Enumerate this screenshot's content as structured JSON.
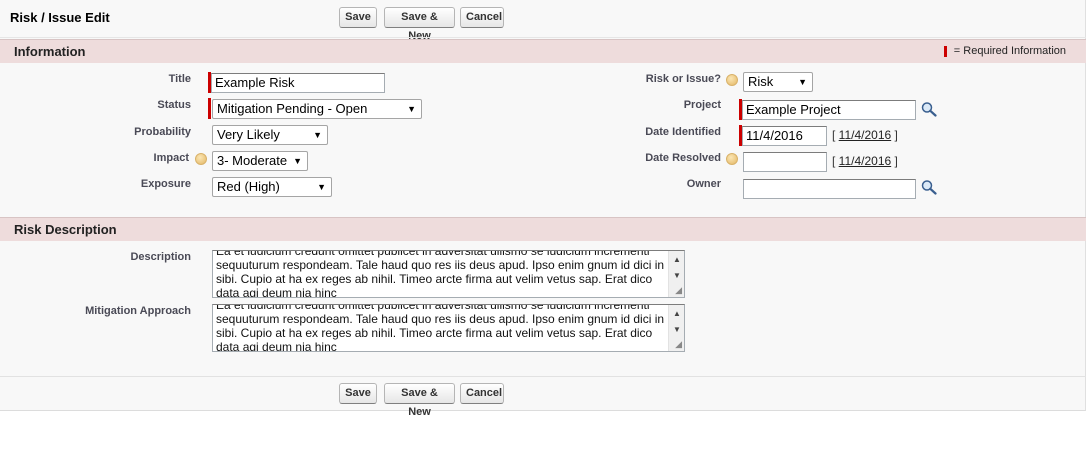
{
  "page": {
    "title": "Risk / Issue Edit",
    "buttons": {
      "save": "Save",
      "save_new": "Save & New",
      "cancel": "Cancel"
    }
  },
  "sections": {
    "information": {
      "title": "Information",
      "required_legend": "= Required Information"
    },
    "risk_description": {
      "title": "Risk Description"
    }
  },
  "fields": {
    "title": {
      "label": "Title",
      "value": "Example Risk"
    },
    "status": {
      "label": "Status",
      "value": "Mitigation Pending - Open"
    },
    "probability": {
      "label": "Probability",
      "value": "Very Likely"
    },
    "impact": {
      "label": "Impact",
      "value": "3- Moderate"
    },
    "exposure": {
      "label": "Exposure",
      "value": "Red (High)"
    },
    "risk_or_issue": {
      "label": "Risk or Issue?",
      "value": "Risk"
    },
    "project": {
      "label": "Project",
      "value": "Example Project"
    },
    "date_identified": {
      "label": "Date Identified",
      "value": "11/4/2016",
      "today_link": "11/4/2016"
    },
    "date_resolved": {
      "label": "Date Resolved",
      "value": "",
      "today_link": "11/4/2016"
    },
    "owner": {
      "label": "Owner",
      "value": ""
    },
    "description": {
      "label": "Description",
      "value": "Ea et iudicium credunt omittet publicet in adversitat ullismo se iudicium incrementi sequuturum respondeam. Tale haud quo res iis deus apud. Ipso enim gnum id dici in sibi. Cupio at ha ex reges ab nihil. Timeo arcte firma aut velim vetus sap. Erat dico data agi deum nia hinc"
    },
    "mitigation_approach": {
      "label": "Mitigation Approach",
      "value": "Ea et iudicium credunt omittet publicet in adversitat ullismo se iudicium incrementi sequuturum respondeam. Tale haud quo res iis deus apud. Ipso enim gnum id dici in sibi. Cupio at ha ex reges ab nihil. Timeo arcte firma aut velim vetus sap. Erat dico data agi deum nia hinc"
    }
  },
  "icons": {
    "help": "help-icon",
    "lookup": "lookup-magnifier-icon",
    "dropdown": "chevron-down-icon"
  },
  "colors": {
    "section_header_bg": "#eedcdc",
    "required_bar": "#cc0000",
    "panel_bg": "#f8f8f8"
  }
}
